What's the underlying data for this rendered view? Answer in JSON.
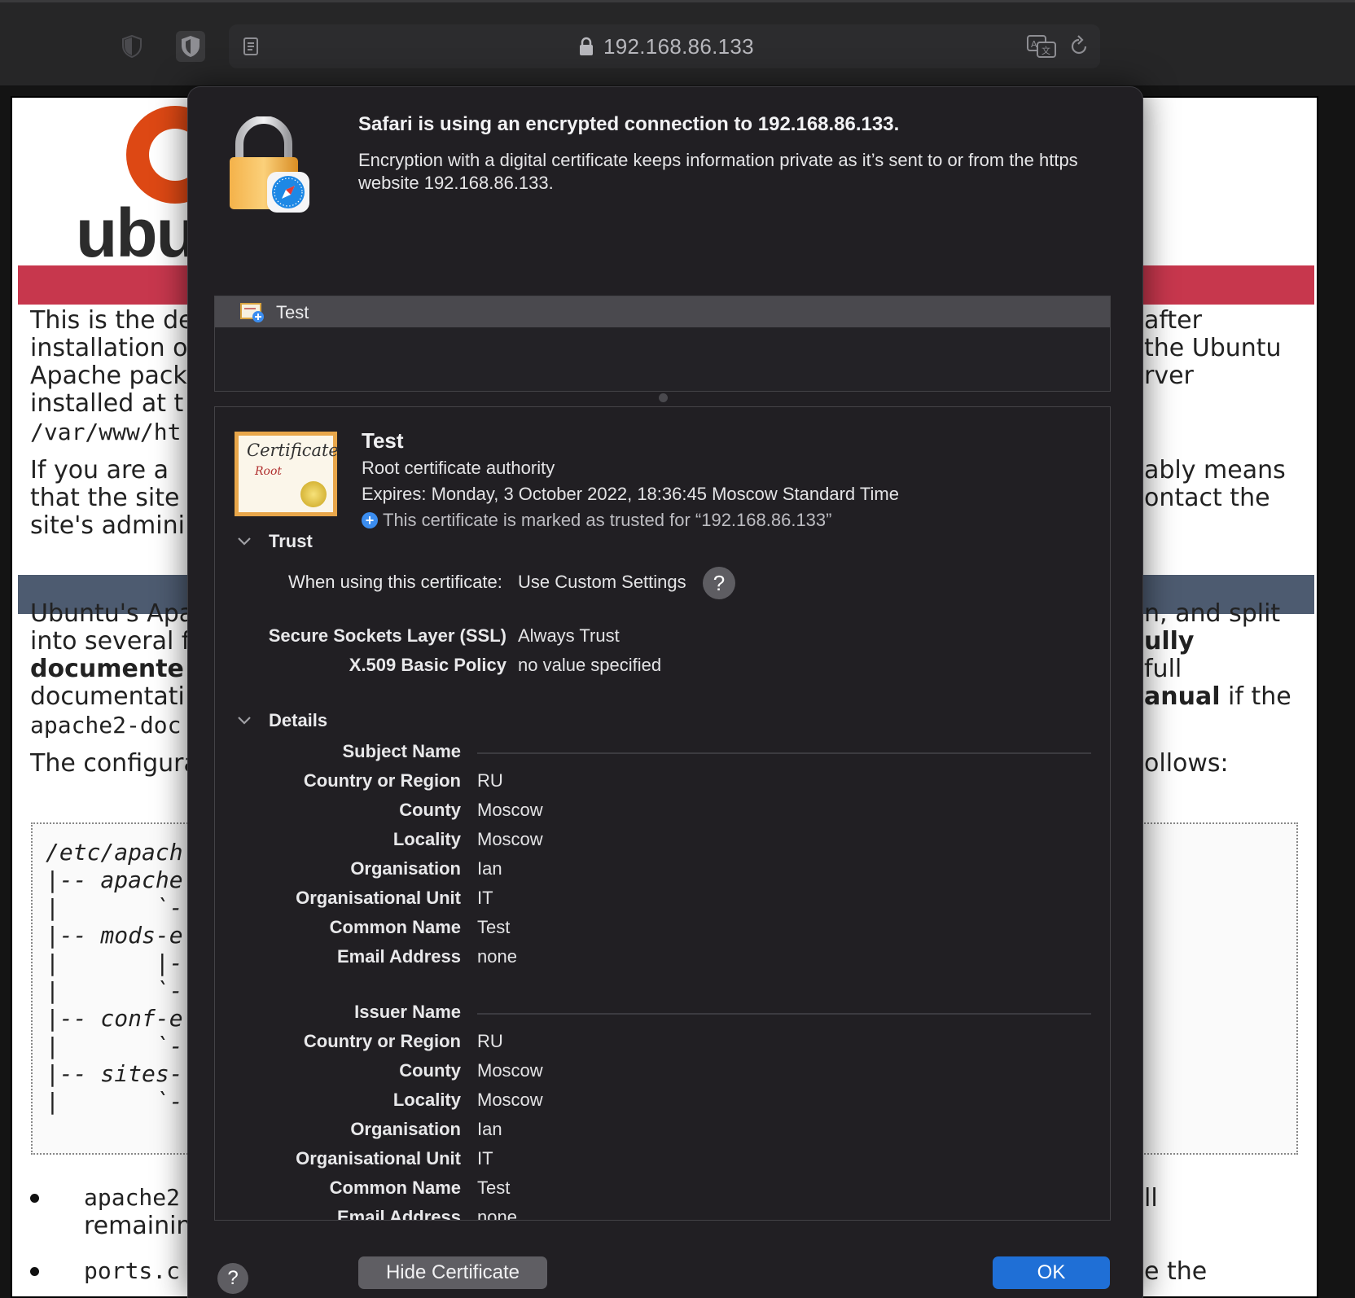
{
  "browser": {
    "url": "192.168.86.133"
  },
  "background_page": {
    "logo_text": "ubu",
    "col_left": [
      "This is the de",
      "installation o",
      "Apache pack",
      "installed at t"
    ],
    "col_left_path": "/var/www/ht",
    "col_left2": [
      "If you are a",
      "that the site",
      "site's admini"
    ],
    "col_right": [
      "after",
      "the Ubuntu",
      "rver"
    ],
    "col_right2": [
      "ably means",
      "ontact the"
    ],
    "ubuntu_left": [
      "Ubuntu's Apa",
      "into several f"
    ],
    "ubuntu_left_bold": "documente",
    "ubuntu_left3": "documentati",
    "ubuntu_left_mono": "apache2-doc",
    "ubuntu_right": [
      "n, and split"
    ],
    "ubuntu_right_bold": "ully",
    "ubuntu_right3": "full",
    "ubuntu_right_bold2": "anual",
    "ubuntu_right_tail": " if the",
    "config_left": "The configura",
    "config_right": "ollows:",
    "tree_lines": [
      "/etc/apach",
      "|-- apache",
      "|       `-",
      "|-- mods-e",
      "|       |-",
      "|       `-",
      "|-- conf-e",
      "|       `-",
      "|-- sites-",
      "|       `-"
    ],
    "bullet1_mono": "apache2",
    "bullet1_text": "remainin",
    "bullet1_right": "ll",
    "bullet2_mono": "ports.c",
    "bullet2_right": "e the"
  },
  "dialog": {
    "title": "Safari is using an encrypted connection to 192.168.86.133.",
    "description": "Encryption with a digital certificate keeps information private as it’s sent to or from the https website 192.168.86.133.",
    "chain": [
      "Test"
    ],
    "cert": {
      "image_title": "Certificate",
      "image_sub": "Root",
      "name": "Test",
      "kind": "Root certificate authority",
      "expires": "Expires: Monday, 3 October 2022, 18:36:45 Moscow Standard Time",
      "trusted": "This certificate is marked as trusted for “192.168.86.133”"
    },
    "trust": {
      "header": "Trust",
      "when_label": "When using this certificate:",
      "when_value": "Use Custom Settings",
      "ssl_label": "Secure Sockets Layer (SSL)",
      "ssl_value": "Always Trust",
      "x509_label": "X.509 Basic Policy",
      "x509_value": "no value specified"
    },
    "details": {
      "header": "Details",
      "subject_header": "Subject Name",
      "subject": [
        {
          "label": "Country or Region",
          "value": "RU"
        },
        {
          "label": "County",
          "value": "Moscow"
        },
        {
          "label": "Locality",
          "value": "Moscow"
        },
        {
          "label": "Organisation",
          "value": "Ian"
        },
        {
          "label": "Organisational Unit",
          "value": "IT"
        },
        {
          "label": "Common Name",
          "value": "Test"
        },
        {
          "label": "Email Address",
          "value": "none"
        }
      ],
      "issuer_header": "Issuer Name",
      "issuer": [
        {
          "label": "Country or Region",
          "value": "RU"
        },
        {
          "label": "County",
          "value": "Moscow"
        },
        {
          "label": "Locality",
          "value": "Moscow"
        },
        {
          "label": "Organisation",
          "value": "Ian"
        },
        {
          "label": "Organisational Unit",
          "value": "IT"
        },
        {
          "label": "Common Name",
          "value": "Test"
        },
        {
          "label": "Email Address",
          "value": "none"
        }
      ]
    },
    "buttons": {
      "help": "?",
      "hide_certificate": "Hide Certificate",
      "ok": "OK"
    },
    "colors": {
      "dialog_bg": "#211f23",
      "ok_button": "#1f6fd6",
      "trusted_icon": "#3b8df0"
    }
  }
}
